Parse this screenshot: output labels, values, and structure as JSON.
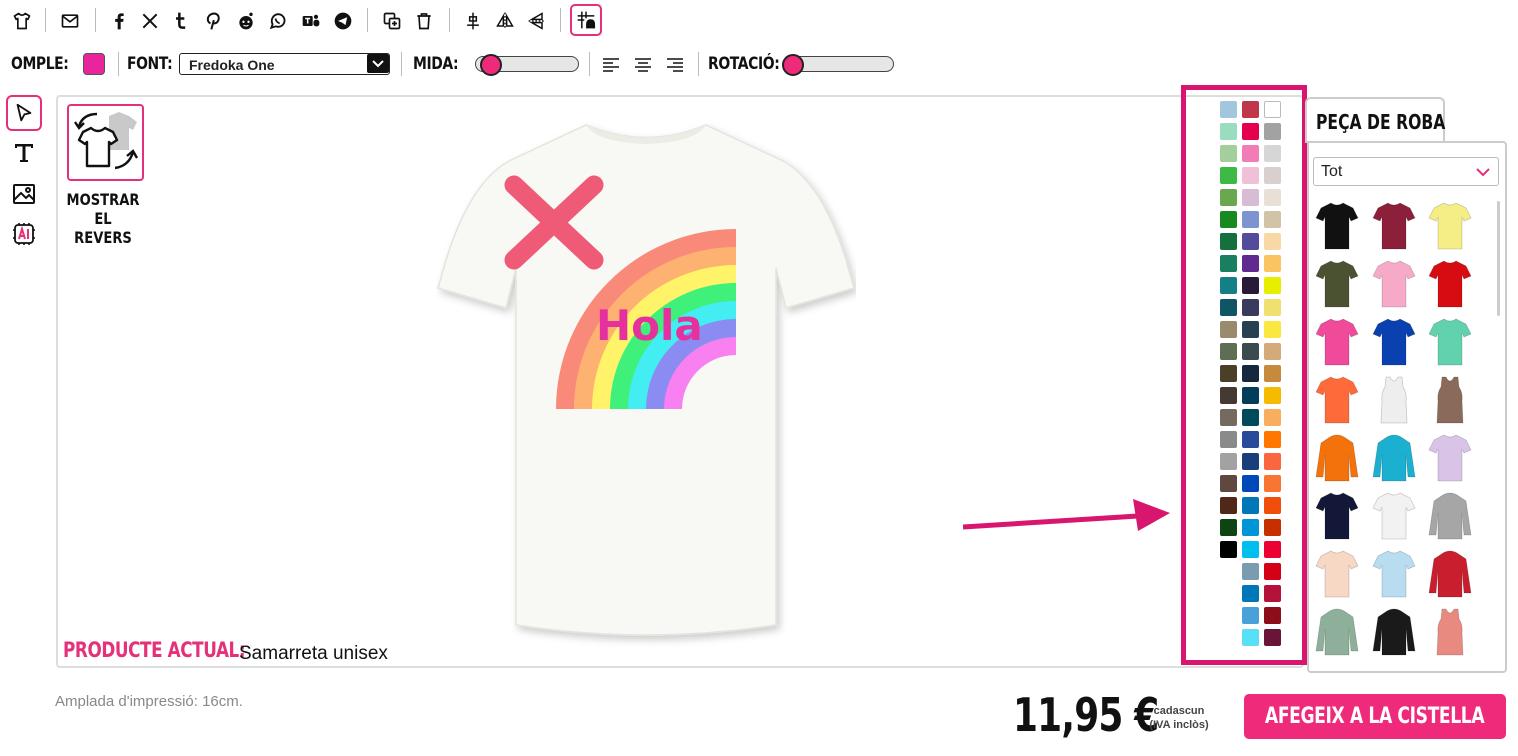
{
  "toolbar": {
    "fill_label": "OMPLE:",
    "fill_color": "#e8259a",
    "font_label": "FONT:",
    "font_value": "Fredoka One",
    "size_label": "MIDA:",
    "size_value": 0.08,
    "rotation_label": "ROTACIÓ:",
    "rotation_value": 0.0,
    "icons": [
      "tshirt-icon",
      "mail-icon",
      "facebook-icon",
      "x-icon",
      "tumblr-icon",
      "pinterest-icon",
      "reddit-icon",
      "whatsapp-icon",
      "teams-icon",
      "telegram-icon",
      "duplicate-icon",
      "trash-icon",
      "center-vertical-icon",
      "flip-horizontal-icon",
      "flip-vertical-icon",
      "grid-snap-icon"
    ]
  },
  "left_tools": [
    "select-tool-icon",
    "text-tool-icon",
    "image-tool-icon",
    "ai-tool-icon"
  ],
  "canvas": {
    "show_back_label_line1": "MOSTRAR",
    "show_back_label_line2": "EL REVERS",
    "design_text": "Hola",
    "current_product_label": "PRODUCTE ACTUAL:",
    "current_product_value": "Samarreta unisex"
  },
  "palette": {
    "col1": [
      "#a2c6de",
      "#9adcc0",
      "#a4ce9c",
      "#3cba45",
      "#6aa84f",
      "#168a1e",
      "#16703e",
      "#1a7e60",
      "#137f86",
      "#0f5566",
      "#9a8a6e",
      "#5e6e52",
      "#4a4028",
      "#443a32",
      "#746a60",
      "#8a8a8a",
      "#a2a2a2",
      "#604840",
      "#502818",
      "#0e4414",
      "#000000"
    ],
    "col2": [
      "#c0364a",
      "#e4004f",
      "#f27cb5",
      "#f0c0d6",
      "#d8bcd4",
      "#7e94d0",
      "#544c9a",
      "#602a8e",
      "#2a1a3a",
      "#3a3a5e",
      "#264052",
      "#3a4a4e",
      "#14283e",
      "#003e5a",
      "#004a5e",
      "#2a4a9a",
      "#1a3e7a",
      "#004ab8",
      "#0078b8",
      "#0094d8",
      "#00bef0",
      "#7a9cb0",
      "#0078b8",
      "#4aa0d8",
      "#5ae0f6"
    ],
    "col3": [
      "#ffffff",
      "#a2a2a2",
      "#d6d6d6",
      "#d8d0cc",
      "#e8e0d4",
      "#d2c2a6",
      "#fad8a6",
      "#fac460",
      "#e8ee00",
      "#f0e070",
      "#fae840",
      "#d4aa78",
      "#c68a3c",
      "#f6ba00",
      "#f8ae5e",
      "#ff7600",
      "#fa6640",
      "#f87632",
      "#f04e0a",
      "#c63000",
      "#ec0034",
      "#d40016",
      "#b4123a",
      "#8e0d1a",
      "#6a1438"
    ]
  },
  "garment_panel": {
    "tab_label": "PEÇA DE ROBA",
    "category_value": "Tot",
    "items": [
      {
        "name": "black-tshirt",
        "color": "#111111"
      },
      {
        "name": "burgundy-tshirt",
        "color": "#8c1f3a"
      },
      {
        "name": "yellow-tshirt",
        "color": "#f5ee86"
      },
      {
        "name": "olive-tshirt",
        "color": "#4b5232"
      },
      {
        "name": "pink-tshirt",
        "color": "#f7aac8"
      },
      {
        "name": "red-tshirt",
        "color": "#d70c10"
      },
      {
        "name": "fuchsia-tshirt",
        "color": "#f04a9a"
      },
      {
        "name": "royal-blue-tshirt",
        "color": "#0a40b0"
      },
      {
        "name": "mint-tshirt",
        "color": "#62d1ae"
      },
      {
        "name": "orange-tshirt",
        "color": "#ff6a3a"
      },
      {
        "name": "white-tank",
        "color": "#eeeeee"
      },
      {
        "name": "brown-tank",
        "color": "#8a6a58"
      },
      {
        "name": "orange-hoodie",
        "color": "#f4720c"
      },
      {
        "name": "cyan-hoodie",
        "color": "#1cb0d0"
      },
      {
        "name": "tie-dye-tshirt",
        "color": "#d9c4e8"
      },
      {
        "name": "navy-tshirt",
        "color": "#141838"
      },
      {
        "name": "white-raglan",
        "color": "#f2f2f2"
      },
      {
        "name": "grey-hoodie",
        "color": "#a6a6a6"
      },
      {
        "name": "peach-tshirt",
        "color": "#f6d8c4"
      },
      {
        "name": "blue-fade-tshirt",
        "color": "#b8dcf0"
      },
      {
        "name": "red-varsity-jacket",
        "color": "#c81e2e"
      },
      {
        "name": "sage-longsleeve",
        "color": "#8eb09a"
      },
      {
        "name": "black-orange-hoodie",
        "color": "#1a1a1a"
      },
      {
        "name": "salmon-tank",
        "color": "#e88a80"
      }
    ]
  },
  "footer": {
    "print_width": "Amplada d'impressió: 16cm.",
    "price": "11,95 €",
    "each_line1": "cadascun",
    "each_line2": "(IVA inclòs)",
    "add_button": "AFEGEIX A LA CISTELLA"
  },
  "colors": {
    "accent": "#f02a7a",
    "highlight": "#d9166f"
  }
}
